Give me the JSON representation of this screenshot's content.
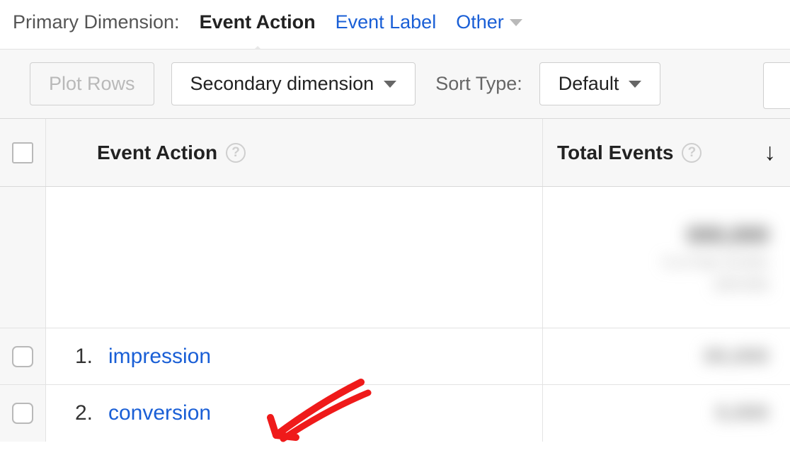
{
  "primaryDimension": {
    "label": "Primary Dimension:",
    "active": "Event Action",
    "tabs": [
      "Event Label",
      "Other"
    ]
  },
  "toolbar": {
    "plotRows": "Plot Rows",
    "secondaryDimension": "Secondary dimension",
    "sortTypeLabel": "Sort Type:",
    "sortDefault": "Default"
  },
  "headers": {
    "eventAction": "Event Action",
    "totalEvents": "Total Events"
  },
  "rows": [
    {
      "num": "1.",
      "label": "impression"
    },
    {
      "num": "2.",
      "label": "conversion"
    }
  ]
}
